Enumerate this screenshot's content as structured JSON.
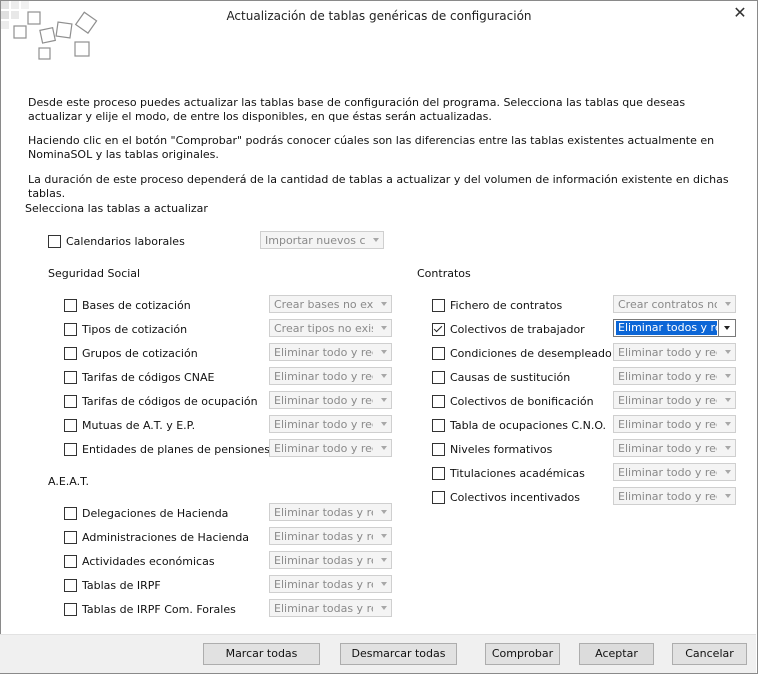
{
  "window": {
    "title": "Actualización de tablas genéricas de configuración"
  },
  "intro": {
    "p1": "Desde este proceso puedes actualizar las tablas base de configuración del programa. Selecciona las tablas que deseas actualizar y elije el modo, de entre los disponibles, en que éstas serán actualizadas.",
    "p2": "Haciendo clic en el botón \"Comprobar\" podrás conocer cúales son las diferencias entre las tablas existentes actualmente en NominaSOL y las tablas originales.",
    "p3": "La duración de este proceso dependerá de la cantidad de tablas a actualizar y del volumen de información existente en dichas tablas."
  },
  "select_label": "Selecciona las tablas a actualizar",
  "calendarios": {
    "label": "Calendarios laborales",
    "mode": "Importar nuevos cal",
    "checked": false
  },
  "seguridad_social": {
    "heading": "Seguridad Social",
    "items": [
      {
        "label": "Bases de cotización",
        "mode": "Crear bases no exist",
        "checked": false
      },
      {
        "label": "Tipos de cotización",
        "mode": "Crear tipos no exist",
        "checked": false
      },
      {
        "label": "Grupos de cotización",
        "mode": "Eliminar todo y recc",
        "checked": false
      },
      {
        "label": "Tarifas de códigos CNAE",
        "mode": "Eliminar todo y recc",
        "checked": false
      },
      {
        "label": "Tarifas de códigos de ocupación",
        "mode": "Eliminar todo y recc",
        "checked": false
      },
      {
        "label": "Mutuas de A.T. y E.P.",
        "mode": "Eliminar todo y recc",
        "checked": false
      },
      {
        "label": "Entidades de planes de pensiones",
        "mode": "Eliminar todo y recc",
        "checked": false
      }
    ]
  },
  "aeat": {
    "heading": "A.E.A.T.",
    "items": [
      {
        "label": "Delegaciones de Hacienda",
        "mode": "Eliminar todas y rec",
        "checked": false
      },
      {
        "label": "Administraciones de Hacienda",
        "mode": "Eliminar todas y rec",
        "checked": false
      },
      {
        "label": "Actividades económicas",
        "mode": "Eliminar todas y rec",
        "checked": false
      },
      {
        "label": "Tablas de IRPF",
        "mode": "Eliminar todas y rec",
        "checked": false
      },
      {
        "label": "Tablas de IRPF Com. Forales",
        "mode": "Eliminar todas y rec",
        "checked": false
      }
    ]
  },
  "contratos": {
    "heading": "Contratos",
    "items": [
      {
        "label": "Fichero de contratos",
        "mode": "Crear contratos no",
        "checked": false
      },
      {
        "label": "Colectivos de trabajador",
        "mode": "Eliminar todos y rec",
        "checked": true
      },
      {
        "label": "Condiciones de desempleado",
        "mode": "Eliminar todo y recc",
        "checked": false
      },
      {
        "label": "Causas de sustitución",
        "mode": "Eliminar todo y recc",
        "checked": false
      },
      {
        "label": "Colectivos de bonificación",
        "mode": "Eliminar todo y recc",
        "checked": false
      },
      {
        "label": "Tabla de ocupaciones C.N.O.",
        "mode": "Eliminar todo y recc",
        "checked": false
      },
      {
        "label": "Niveles formativos",
        "mode": "Eliminar todo y recc",
        "checked": false
      },
      {
        "label": "Titulaciones académicas",
        "mode": "Eliminar todo y recc",
        "checked": false
      },
      {
        "label": "Colectivos incentivados",
        "mode": "Eliminar todo y recc",
        "checked": false
      }
    ]
  },
  "buttons": {
    "marcar": "Marcar todas",
    "desmarcar": "Desmarcar todas",
    "comprobar": "Comprobar",
    "aceptar": "Aceptar",
    "cancelar": "Cancelar"
  },
  "colors": {
    "selection": "#0c66d6",
    "footer": "#f0f0f0"
  }
}
